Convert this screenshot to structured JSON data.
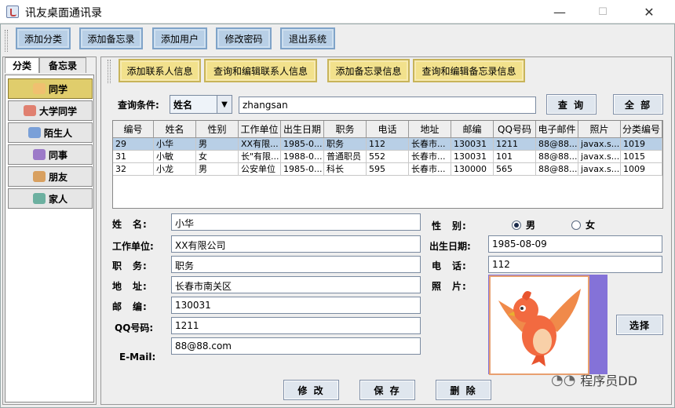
{
  "window": {
    "title": "讯友桌面通讯录",
    "minimize": "—",
    "maximize": "☐",
    "close": "✕"
  },
  "toolbar": {
    "buttons": [
      "添加分类",
      "添加备忘录",
      "添加用户",
      "修改密码",
      "退出系统"
    ]
  },
  "sidebar": {
    "tabs": [
      "分类",
      "备忘录"
    ],
    "categories": [
      "同学",
      "大学同学",
      "陌生人",
      "同事",
      "朋友",
      "家人"
    ],
    "selected_index": 0
  },
  "main_tabs": [
    "添加联系人信息",
    "查询和编辑联系人信息",
    "添加备忘录信息",
    "查询和编辑备忘录信息"
  ],
  "query": {
    "label": "查询条件:",
    "field_selected": "姓名",
    "value": "zhangsan",
    "search_button": "查 询",
    "all_button": "全 部"
  },
  "table": {
    "columns": [
      "编号",
      "姓名",
      "性别",
      "工作单位",
      "出生日期",
      "职务",
      "电话",
      "地址",
      "邮编",
      "QQ号码",
      "电子邮件",
      "照片",
      "分类编号"
    ],
    "rows": [
      [
        "29",
        "小华",
        "男",
        "XX有限...",
        "1985-0...",
        "职务",
        "112",
        "长春市...",
        "130031",
        "1211",
        "88@88...",
        "javax.s...",
        "1019"
      ],
      [
        "31",
        "小敏",
        "女",
        "长\"有限...",
        "1988-0...",
        "普通职员",
        "552",
        "长春市...",
        "130031",
        "101",
        "88@88...",
        "javax.s...",
        "1015"
      ],
      [
        "32",
        "小龙",
        "男",
        "公安单位",
        "1985-0...",
        "科长",
        "595",
        "长春市...",
        "130000",
        "565",
        "88@88...",
        "javax.s...",
        "1009"
      ]
    ],
    "selected_row": 0
  },
  "form": {
    "name_label": "姓　名:",
    "name_value": "小华",
    "company_label": "工作单位:",
    "company_value": "XX有限公司",
    "position_label": "职　务:",
    "position_value": "职务",
    "address_label": "地　址:",
    "address_value": "长春市南关区",
    "zip_label": "邮　编:",
    "zip_value": "130031",
    "qq_label": "QQ号码:",
    "qq_value": "1211",
    "email_label": "E-Mail:",
    "email_value": "88@88.com",
    "gender_label": "性　别:",
    "gender_male": "男",
    "gender_female": "女",
    "gender_selected": "男",
    "birth_label": "出生日期:",
    "birth_value": "1985-08-09",
    "phone_label": "电　话:",
    "phone_value": "112",
    "photo_label": "照　片:",
    "choose_button": "选择",
    "modify_button": "修 改",
    "save_button": "保 存",
    "delete_button": "删 除"
  },
  "watermark": "程序员DD",
  "colors": {
    "toolbar_button": "#b8cfe6",
    "tab_button": "#f2e18c",
    "selected_category": "#e0cd6c",
    "selected_row": "#b8cfe6",
    "photo_side": "#8472d8"
  }
}
